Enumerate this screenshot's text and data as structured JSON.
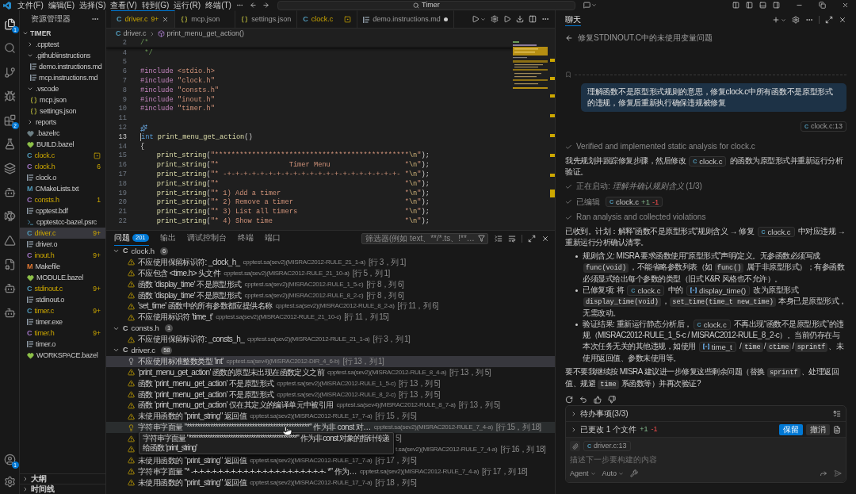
{
  "title_bar": {
    "menus": [
      "文件(F)",
      "编辑(E)",
      "选择(S)",
      "查看(V)",
      "转到(G)",
      "运行(R)",
      "终端(T)"
    ],
    "search": "Timer"
  },
  "activity_bar": {
    "explorer_badge": "1",
    "extensions_badge": "2",
    "account_badge": "1"
  },
  "explorer": {
    "title": "资源管理器",
    "root": "TIMER",
    "root_expanded": true,
    "items": [
      {
        "kind": "folder",
        "name": ".cpptest",
        "expanded": false,
        "selected": false
      },
      {
        "kind": "folder",
        "name": ".github\\instructions",
        "expanded": true,
        "selected": false,
        "children": [
          {
            "kind": "text",
            "name": "demo.instructions.md",
            "selected": false,
            "warning": false,
            "pending_edit": false
          },
          {
            "kind": "text",
            "name": "mcp.instructions.md",
            "selected": false,
            "warning": false,
            "pending_edit": false
          }
        ]
      },
      {
        "kind": "folder",
        "name": ".vscode",
        "expanded": true,
        "selected": false,
        "children": [
          {
            "kind": "json",
            "name": "mcp.json",
            "selected": false,
            "warning": false,
            "pending_edit": false
          },
          {
            "kind": "json",
            "name": "settings.json",
            "selected": false,
            "warning": false,
            "pending_edit": false
          }
        ]
      },
      {
        "kind": "folder",
        "name": "reports",
        "expanded": false,
        "selected": false
      },
      {
        "kind": "bazelrc",
        "name": ".bazelrc",
        "selected": false,
        "warning": false,
        "pending_edit": false
      },
      {
        "kind": "bazel",
        "name": "BUILD.bazel",
        "selected": false,
        "warning": false,
        "pending_edit": false
      },
      {
        "kind": "c",
        "glyph": "C",
        "name": "clock.c",
        "selected": false,
        "warning": true,
        "pending_edit": true
      },
      {
        "kind": "h",
        "glyph": "C",
        "name": "clock.h",
        "badge": "6",
        "selected": false,
        "warning": true,
        "pending_edit": false
      },
      {
        "kind": "text",
        "name": "clock.o",
        "selected": false,
        "warning": false,
        "pending_edit": false
      },
      {
        "kind": "cmake",
        "glyph": "M",
        "name": "CMakeLists.txt",
        "selected": false,
        "warning": false,
        "pending_edit": false
      },
      {
        "kind": "h",
        "glyph": "C",
        "name": "consts.h",
        "badge": "1",
        "selected": false,
        "warning": true,
        "pending_edit": false
      },
      {
        "kind": "text",
        "name": "cpptest.bdf",
        "selected": false,
        "warning": false,
        "pending_edit": false
      },
      {
        "kind": "shell",
        "name": "cpptestcc-bazel.psrc",
        "selected": false,
        "warning": false,
        "pending_edit": false
      },
      {
        "kind": "c",
        "glyph": "C",
        "name": "driver.c",
        "badge": "9+",
        "selected": true,
        "warning": true,
        "pending_edit": false
      },
      {
        "kind": "text",
        "name": "driver.o",
        "selected": false,
        "warning": false,
        "pending_edit": false
      },
      {
        "kind": "h",
        "glyph": "C",
        "name": "inout.h",
        "badge": "9+",
        "selected": false,
        "warning": true,
        "pending_edit": false
      },
      {
        "kind": "makefile",
        "glyph": "M",
        "name": "Makefile",
        "selected": false,
        "warning": false,
        "pending_edit": false
      },
      {
        "kind": "bazel",
        "name": "MODULE.bazel",
        "selected": false,
        "warning": false,
        "pending_edit": false
      },
      {
        "kind": "c",
        "glyph": "C",
        "name": "stdinout.c",
        "badge": "9+",
        "selected": false,
        "warning": true,
        "pending_edit": false
      },
      {
        "kind": "text",
        "name": "stdinout.o",
        "selected": false,
        "warning": false,
        "pending_edit": false
      },
      {
        "kind": "c",
        "glyph": "C",
        "name": "timer.c",
        "badge": "9+",
        "selected": false,
        "warning": true,
        "pending_edit": false
      },
      {
        "kind": "text",
        "name": "timer.exe",
        "selected": false,
        "warning": false,
        "pending_edit": false
      },
      {
        "kind": "h",
        "glyph": "C",
        "name": "timer.h",
        "badge": "9+",
        "selected": false,
        "warning": true,
        "pending_edit": false
      },
      {
        "kind": "text",
        "name": "timer.o",
        "selected": false,
        "warning": false,
        "pending_edit": false
      },
      {
        "kind": "bazel",
        "name": "WORKSPACE.bazel",
        "selected": false,
        "warning": false,
        "pending_edit": false
      }
    ]
  },
  "sidebar_sections": [
    {
      "label": "大纲",
      "expanded": false
    },
    {
      "label": "时间线",
      "expanded": false
    }
  ],
  "editor": {
    "tabs": [
      {
        "kind": "c",
        "glyph": "C",
        "label": "driver.c",
        "badge": "9+",
        "warning": true,
        "selected": true,
        "dirty": false,
        "pending_edit": false
      },
      {
        "kind": "json",
        "label": "mcp.json",
        "warning": false,
        "selected": false,
        "dirty": false,
        "pending_edit": false
      },
      {
        "kind": "json",
        "label": "settings.json",
        "warning": false,
        "selected": false,
        "dirty": false,
        "pending_edit": false
      },
      {
        "kind": "c",
        "glyph": "C",
        "label": "clock.c",
        "warning": true,
        "selected": false,
        "dirty": false,
        "pending_edit": true
      },
      {
        "kind": "text",
        "label": "demo.instructions.md",
        "warning": false,
        "selected": false,
        "dirty": true,
        "pending_edit": false
      }
    ],
    "breadcrumb": [
      {
        "kind": "c",
        "glyph": "C",
        "label": "driver.c"
      },
      {
        "kind": "method",
        "label": "print_menu_get_action()"
      }
    ],
    "sticky_lines": [
      {
        "number": "2",
        "current": false,
        "gutter_icon": false,
        "tokens": [
          {
            "kind": "comment",
            "text": "/*"
          }
        ]
      }
    ],
    "lines": [
      {
        "number": "4",
        "current": false,
        "gutter_icon": false,
        "tokens": [
          {
            "kind": "comment",
            "text": " */"
          }
        ]
      },
      {
        "number": "5",
        "current": false,
        "gutter_icon": false
      },
      {
        "number": "6",
        "current": false,
        "gutter_icon": false,
        "tokens": [
          {
            "kind": "preproc",
            "text": "#include"
          },
          {
            "kind": "include",
            "text": " <stdio.h>"
          }
        ]
      },
      {
        "number": "7",
        "current": false,
        "gutter_icon": false,
        "tokens": [
          {
            "kind": "preproc",
            "text": "#include"
          },
          {
            "kind": "include",
            "text": " \"clock.h\""
          }
        ]
      },
      {
        "number": "8",
        "current": false,
        "gutter_icon": false,
        "tokens": [
          {
            "kind": "preproc",
            "text": "#include"
          },
          {
            "kind": "include",
            "text": " \"consts.h\""
          }
        ]
      },
      {
        "number": "9",
        "current": false,
        "gutter_icon": false,
        "tokens": [
          {
            "kind": "preproc",
            "text": "#include"
          },
          {
            "kind": "include",
            "text": " \"inout.h\""
          }
        ]
      },
      {
        "number": "10",
        "current": false,
        "gutter_icon": false,
        "tokens": [
          {
            "kind": "preproc",
            "text": "#include"
          },
          {
            "kind": "include",
            "text": " \"timer.h\""
          }
        ]
      },
      {
        "number": "11",
        "current": false,
        "gutter_icon": false
      },
      {
        "number": "12",
        "current": false,
        "gutter_icon": true
      },
      {
        "number": "13",
        "current": true,
        "gutter_icon": false,
        "tokens": [
          {
            "kind": "keyword",
            "text": "int"
          },
          {
            "kind": "function",
            "text": " print_menu_get_action"
          },
          {
            "kind": "punct",
            "text": "()"
          }
        ]
      },
      {
        "number": "14",
        "current": false,
        "gutter_icon": false,
        "tokens": [
          {
            "kind": "punct",
            "text": "{"
          }
        ]
      },
      {
        "number": "15",
        "current": false,
        "gutter_icon": false,
        "tokens": [
          {
            "kind": "function",
            "text": "    print_string"
          },
          {
            "kind": "punct",
            "text": "("
          },
          {
            "kind": "string",
            "text": "\"***********************************************"
          },
          {
            "kind": "escape",
            "text": "\\n"
          },
          {
            "kind": "string",
            "text": "\""
          },
          {
            "kind": "punct",
            "text": ");"
          }
        ]
      },
      {
        "number": "16",
        "current": false,
        "gutter_icon": false,
        "tokens": [
          {
            "kind": "function",
            "text": "    print_string"
          },
          {
            "kind": "punct",
            "text": "("
          },
          {
            "kind": "string",
            "text": "\"*                 Timer Menu                  *"
          },
          {
            "kind": "escape",
            "text": "\\n"
          },
          {
            "kind": "string",
            "text": "\""
          },
          {
            "kind": "punct",
            "text": ");"
          }
        ]
      },
      {
        "number": "17",
        "current": false,
        "gutter_icon": false,
        "tokens": [
          {
            "kind": "function",
            "text": "    print_string"
          },
          {
            "kind": "punct",
            "text": "("
          },
          {
            "kind": "string",
            "text": "\"* -+-+-+-+-+-+-+-+-+-+-+-+-+-+-+-+-+-+-+-+-+- *"
          },
          {
            "kind": "escape",
            "text": "\\n"
          },
          {
            "kind": "string",
            "text": "\""
          },
          {
            "kind": "punct",
            "text": ");"
          }
        ]
      },
      {
        "number": "18",
        "current": false,
        "gutter_icon": false,
        "tokens": [
          {
            "kind": "function",
            "text": "    print_string"
          },
          {
            "kind": "punct",
            "text": "("
          },
          {
            "kind": "string",
            "text": "\"*                                             *"
          },
          {
            "kind": "escape",
            "text": "\\n"
          },
          {
            "kind": "string",
            "text": "\""
          },
          {
            "kind": "punct",
            "text": ");"
          }
        ]
      },
      {
        "number": "19",
        "current": false,
        "gutter_icon": false,
        "tokens": [
          {
            "kind": "function",
            "text": "    print_string"
          },
          {
            "kind": "punct",
            "text": "("
          },
          {
            "kind": "string",
            "text": "\"* 1) Add a timer                              *"
          },
          {
            "kind": "escape",
            "text": "\\n"
          },
          {
            "kind": "string",
            "text": "\""
          },
          {
            "kind": "punct",
            "text": ");"
          }
        ]
      },
      {
        "number": "20",
        "current": false,
        "gutter_icon": false,
        "tokens": [
          {
            "kind": "function",
            "text": "    print_string"
          },
          {
            "kind": "punct",
            "text": "("
          },
          {
            "kind": "string",
            "text": "\"* 2) Remove a timer                           *"
          },
          {
            "kind": "escape",
            "text": "\\n"
          },
          {
            "kind": "string",
            "text": "\""
          },
          {
            "kind": "punct",
            "text": ");"
          }
        ]
      },
      {
        "number": "21",
        "current": false,
        "gutter_icon": false,
        "tokens": [
          {
            "kind": "function",
            "text": "    print_string"
          },
          {
            "kind": "punct",
            "text": "("
          },
          {
            "kind": "string",
            "text": "\"* 3) List all timers                          *"
          },
          {
            "kind": "escape",
            "text": "\\n"
          },
          {
            "kind": "string",
            "text": "\""
          },
          {
            "kind": "punct",
            "text": ");"
          }
        ]
      },
      {
        "number": "22",
        "current": false,
        "gutter_icon": false,
        "tokens": [
          {
            "kind": "function",
            "text": "    print_string"
          },
          {
            "kind": "punct",
            "text": "("
          },
          {
            "kind": "string",
            "text": "\"* 4) Show time                                *"
          },
          {
            "kind": "escape",
            "text": "\\n"
          },
          {
            "kind": "string",
            "text": "\""
          },
          {
            "kind": "punct",
            "text": ");"
          }
        ]
      }
    ]
  },
  "problems": {
    "tabs": [
      {
        "label": "问题",
        "badge": "201",
        "selected": true
      },
      {
        "label": "输出",
        "selected": false
      },
      {
        "label": "调试控制台",
        "selected": false
      },
      {
        "label": "终端",
        "selected": false
      },
      {
        "label": "端口",
        "selected": false
      }
    ],
    "filter_placeholder": "筛选器(例如 text、**/*.ts、!**…",
    "groups": [
      {
        "glyph": "C",
        "file": "clock.h",
        "count": "6",
        "expanded": true,
        "rows": [
          {
            "message": "不应使用保留标识符: _clock_h_",
            "source": "cpptest.sa(sev2)(MISRAC2012-RULE_21_1-a)",
            "location": "[行 3，列 1]",
            "selected": false,
            "hovered": false
          },
          {
            "message": "不应包含 <time.h> 头文件",
            "source": "cpptest.sa(sev2)(MISRAC2012-RULE_21_10-a)",
            "location": "[行 5，列 1]",
            "selected": false,
            "hovered": false
          },
          {
            "message": "函数 'display_time' 不是原型形式",
            "source": "cpptest.sa(sev2)(MISRAC2012-RULE_1_5-c)",
            "location": "[行 8，列 6]",
            "selected": false,
            "hovered": false
          },
          {
            "message": "函数 'display_time' 不是原型形式",
            "source": "cpptest.sa(sev2)(MISRAC2012-RULE_8_2-c)",
            "location": "[行 8，列 6]",
            "selected": false,
            "hovered": false
          },
          {
            "message": "'set_time' 函数中的所有参数都应提供名称",
            "source": "cpptest.sa(sev2)(MISRAC2012-RULE_8_2-a)",
            "location": "[行 11，列 6]",
            "selected": false,
            "hovered": false
          },
          {
            "message": "不应使用标识符 'time_t'",
            "source": "cpptest.sa(sev2)(MISRAC2012-RULE_21_10-c)",
            "location": "[行 11，列 15]",
            "selected": false,
            "hovered": false
          }
        ]
      },
      {
        "glyph": "C",
        "file": "consts.h",
        "count": "1",
        "expanded": true,
        "rows": [
          {
            "message": "不应使用保留标识符: _consts_h_",
            "source": "cpptest.sa(sev2)(MISRAC2012-RULE_21_1-a)",
            "location": "[行 3，列 1]",
            "selected": false,
            "hovered": false
          }
        ]
      },
      {
        "glyph": "C",
        "file": "driver.c",
        "count": "58",
        "expanded": true,
        "rows": [
          {
            "message": "不应使用标准整数类型 'int'",
            "source": "cpptest.sa(sev4)(MISRAC2012-DIR_4_6-b)",
            "location": "[行 13，列 1]",
            "selected": true,
            "hovered": false
          },
          {
            "message": "'print_menu_get_action' 函数的原型未出现在函数定义之前",
            "source": "cpptest.sa(sev2)(MISRAC2012-RULE_8_4-a)",
            "location": "[行 13，列 5]",
            "selected": false,
            "hovered": false
          },
          {
            "message": "函数 'print_menu_get_action' 不是原型形式",
            "source": "cpptest.sa(sev2)(MISRAC2012-RULE_1_5-c)",
            "location": "[行 13，列 5]",
            "selected": false,
            "hovered": false
          },
          {
            "message": "函数 'print_menu_get_action' 不是原型形式",
            "source": "cpptest.sa(sev2)(MISRAC2012-RULE_8_2-c)",
            "location": "[行 13，列 5]",
            "selected": false,
            "hovered": false
          },
          {
            "message": "函数 'print_menu_get_action' 仅在其定义的编译单元中被引用",
            "source": "cpptest.sa(sev4)(MISRAC2012-RULE_8_7-a)",
            "location": "[行 13，列 5]",
            "selected": false,
            "hovered": false
          },
          {
            "message": "未使用函数的 \"print_string\" 返回值",
            "source": "cpptest.sa(sev2)(MISRAC2012-RULE_17_7-a)",
            "location": "[行 15，列 5]",
            "selected": false,
            "hovered": false
          },
          {
            "message": "字符串字面量 \"***********************************************\" 作为非 const 对…",
            "source": "cpptest.sa(sev2)(MISRAC2012-RULE_7_4-a)",
            "location": "[行 15，列 18]",
            "selected": false,
            "hovered": true
          },
          {
            "location": "5]",
            "selected": false,
            "hovered": false
          },
          {
            "source": "t.sa(sev2)(MISRAC2012-RULE_7_4-a)",
            "location": "[行 16，列 18]",
            "selected": false,
            "hovered": false
          },
          {
            "message": "未使用函数的 \"print_string\" 返回值",
            "source": "cpptest.sa(sev2)(MISRAC2012-RULE_17_7-a)",
            "location": "[行 17，列 5]",
            "selected": false,
            "hovered": false
          },
          {
            "message": "字符串字面量 \"* -+-+-+-+-+-+-+-+-+-+-+-+-+-+-+-+-+-+-+-+-+- *\" 作为…",
            "source": "cpptest.sa(sev2)(MISRAC2012-RULE_7_4-a)",
            "location": "[行 17，列 18]",
            "selected": false,
            "hovered": false
          },
          {
            "message": "未使用函数的 \"print_string\" 返回值",
            "source": "cpptest.sa(sev2)(MISRAC2012-RULE_17_7-a)",
            "location": "[行 18，列 5]",
            "selected": false,
            "hovered": false
          }
        ]
      }
    ],
    "tooltip": "字符串字面量 \"***********************************************\" 作为非 const 对象的指针传递给函数 'print_string'"
  },
  "chat": {
    "tabs": [
      {
        "label": "聊天",
        "selected": true
      }
    ],
    "title": "修复STDINOUT.C中的未使用变量问题",
    "user_message": "理解函数不是原型形式规则的意思，修复clock.c中所有函数不是原型形式的违规，修复后重新执行确保违规被修复",
    "context_chip": {
      "glyph": "C",
      "label": "clock.c:13"
    },
    "blocks": [
      {
        "kind": "step",
        "text": "Verified and implemented static analysis for clock.c"
      },
      {
        "kind": "paragraph",
        "parts": [
          {
            "kind": "text",
            "text": "我先规划并跟踪修复步骤，然后修改 "
          },
          {
            "kind": "file",
            "glyph": "C",
            "text": "clock.c"
          },
          {
            "kind": "text",
            "text": " 的函数为原型形式并重新运行分析验证。"
          }
        ]
      },
      {
        "kind": "step",
        "text": "正在启动: *理解并确认规则含义* (1/3)"
      },
      {
        "kind": "edit",
        "text": "已编辑",
        "file": {
          "glyph": "C",
          "label": "clock.c",
          "added": "+1",
          "removed": "-1"
        }
      },
      {
        "kind": "step",
        "text": "Ran analysis and collected violations"
      },
      {
        "kind": "paragraph",
        "parts": [
          {
            "kind": "text",
            "text": "已收到。计划：解释“函数不是原型形式”规则含义 → 修复 "
          },
          {
            "kind": "file",
            "glyph": "C",
            "text": "clock.c"
          },
          {
            "kind": "text",
            "text": " 中对应违规 → 重新运行分析确认清零。"
          }
        ]
      },
      {
        "kind": "bullets",
        "items": [
          {
            "parts": [
              {
                "kind": "text",
                "text": "规则含义: MISRA 要求函数使用“原型形式”声明/定义。无参函数必须写成 "
              },
              {
                "kind": "code",
                "text": "func(void)"
              },
              {
                "kind": "text",
                "text": "，不能省略参数列表（如 "
              },
              {
                "kind": "code",
                "text": "func()"
              },
              {
                "kind": "text",
                "text": " 属于非原型形式）；有参函数必须显式给出每个参数的类型（旧式 K&R 风格也不允许）。"
              }
            ]
          },
          {
            "parts": [
              {
                "kind": "text",
                "text": "已修复项: 将 "
              },
              {
                "kind": "file",
                "glyph": "C",
                "text": "clock.c"
              },
              {
                "kind": "text",
                "text": " 中的 "
              },
              {
                "kind": "symbol",
                "text": "display_time()"
              },
              {
                "kind": "text",
                "text": " 改为原型形式 "
              },
              {
                "kind": "code",
                "text": "display_time(void)"
              },
              {
                "kind": "text",
                "text": "，"
              },
              {
                "kind": "code",
                "text": "set_time(time_t new_time)"
              },
              {
                "kind": "text",
                "text": " 本身已是原型形式，无需改动。"
              }
            ]
          },
          {
            "parts": [
              {
                "kind": "text",
                "text": "验证结果: 重新运行静态分析后，"
              },
              {
                "kind": "file",
                "glyph": "C",
                "text": "clock.c"
              },
              {
                "kind": "text",
                "text": " 不再出现“函数不是原型形式”的违规（MISRAC2012-RULE_1_5-c / MISRAC2012-RULE_8_2-c）。当前仍存在与本次任务无关的其他违规，如使用 "
              },
              {
                "kind": "symbol",
                "text": "time_t"
              },
              {
                "kind": "text",
                "text": " /"
              },
              {
                "kind": "code",
                "text": "time"
              },
              {
                "kind": "text",
                "text": "/"
              },
              {
                "kind": "code",
                "text": "ctime"
              },
              {
                "kind": "text",
                "text": "/"
              },
              {
                "kind": "code",
                "text": "sprintf"
              },
              {
                "kind": "text",
                "text": "、未使用返回值、参数未使用等。"
              }
            ]
          }
        ]
      },
      {
        "kind": "paragraph",
        "parts": [
          {
            "kind": "text",
            "text": "要不要我继续按 MISRA 建议进一步修复这些剩余问题（替换 "
          },
          {
            "kind": "code",
            "text": "sprintf"
          },
          {
            "kind": "text",
            "text": "、处理返回值、规避 "
          },
          {
            "kind": "code",
            "text": "time"
          },
          {
            "kind": "text",
            "text": " 系函数等）并再次验证?"
          }
        ]
      }
    ],
    "todo": {
      "label": "待办事项(3/3)",
      "expanded": false
    },
    "changes": {
      "label": "已更改 1 个文件",
      "added": "+1",
      "removed": "-1",
      "expanded": false,
      "keep": "保留",
      "undo": "撤消"
    },
    "input": {
      "attachment": {
        "glyph": "C",
        "label": "driver.c:13"
      },
      "placeholder": "描述下一步要构建的内容",
      "mode": "Agent",
      "model": "Auto"
    }
  }
}
